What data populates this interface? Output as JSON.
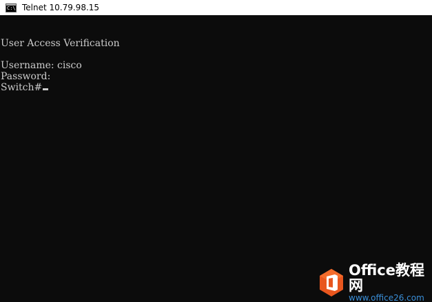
{
  "window": {
    "title": "Telnet 10.79.98.15",
    "icon": "console-icon",
    "icon_glyph": "C:\\"
  },
  "console": {
    "lines": [
      "User Access Verification",
      "",
      "Username: cisco",
      "Password:",
      "Switch#"
    ],
    "colors": {
      "background": "#0c0c0c",
      "text": "#cccccc"
    }
  },
  "watermark": {
    "brand": "Office教程网",
    "url": "www.office26.com",
    "logo_color": "#e8561e",
    "url_color": "#3a8fd9"
  }
}
